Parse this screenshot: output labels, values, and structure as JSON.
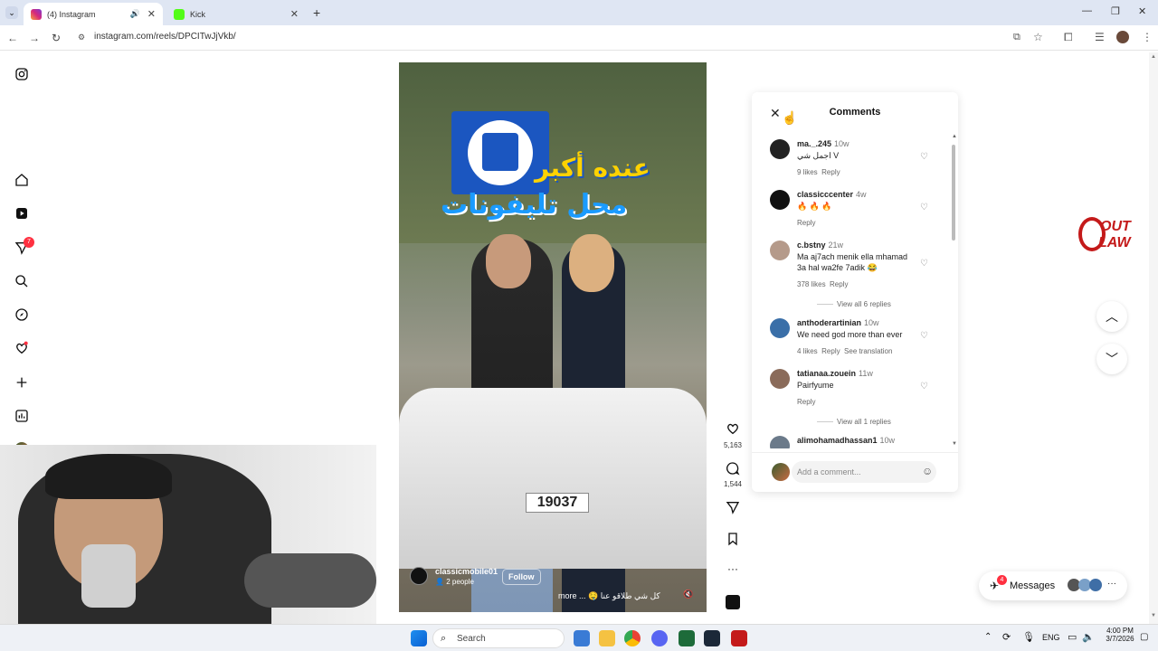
{
  "browser": {
    "tabs": [
      {
        "title": "(4) Instagram",
        "active": true
      },
      {
        "title": "Kick",
        "active": false
      }
    ],
    "url": "instagram.com/reels/DPCITwJjVkb/"
  },
  "sidebar": {
    "notifications_badge": "7"
  },
  "reel": {
    "overlay_title_line1": "عنده أكبر",
    "overlay_title_line2": "محل تليفونات",
    "plate": "19037",
    "username": "classicmobile01",
    "follow_label": "Follow",
    "people": "2 people",
    "caption": "كل شي طلاقو عنا 🤤 ... more",
    "likes": "5,163",
    "comments": "1,544"
  },
  "comments_panel": {
    "title": "Comments",
    "input_placeholder": "Add a comment...",
    "items": [
      {
        "user": "ma._.245",
        "time": "10w",
        "text": "اجمل شي V",
        "likes": "9 likes",
        "reply": "Reply"
      },
      {
        "user": "classicccenter",
        "time": "4w",
        "text": "🔥 🔥 🔥",
        "likes": "",
        "reply": "Reply"
      },
      {
        "user": "c.bstny",
        "time": "21w",
        "text": "Ma aj7ach menik ella mhamad 3a hal wa2fe 7adik 😂",
        "likes": "378 likes",
        "reply": "Reply",
        "view_replies": "View all 6 replies"
      },
      {
        "user": "anthoderartinian",
        "time": "10w",
        "text": "We need god more than ever",
        "likes": "4 likes",
        "reply": "Reply",
        "translate": "See translation"
      },
      {
        "user": "tatianaa.zouein",
        "time": "11w",
        "text": "Pairfyume",
        "likes": "",
        "reply": "Reply",
        "view_replies": "View all 1 replies"
      },
      {
        "user": "alimohamadhassan1",
        "time": "10w",
        "text": "",
        "likes": "",
        "reply": ""
      }
    ]
  },
  "right": {
    "logo_line1": "OUT",
    "logo_line2": "LAW",
    "messages_label": "Messages",
    "messages_badge": "4"
  },
  "taskbar": {
    "search_placeholder": "Search",
    "lang": "ENG",
    "time": "4:00 PM",
    "date": "3/7/2026"
  }
}
